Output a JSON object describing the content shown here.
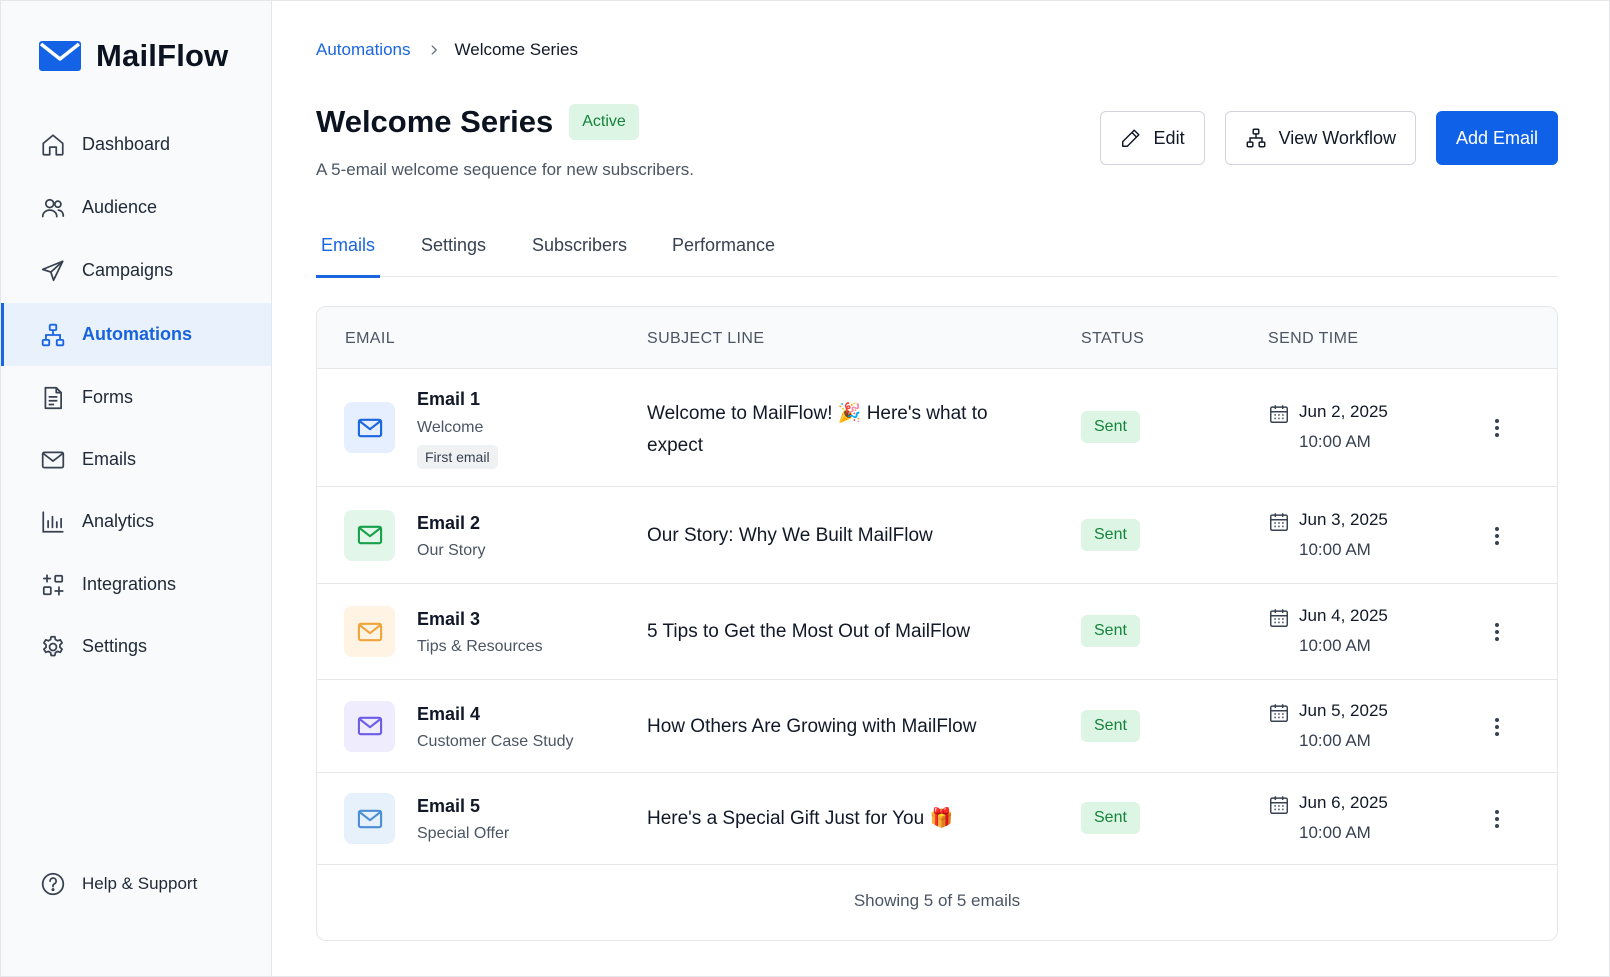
{
  "app": {
    "name": "MailFlow"
  },
  "colors": {
    "accent": "#1a66e0",
    "primary_button": "#0f62e8",
    "success_bg": "#dcf5e4",
    "success_text": "#16833b"
  },
  "sidebar": {
    "items": [
      {
        "label": "Dashboard",
        "icon": "home-icon",
        "active": false
      },
      {
        "label": "Audience",
        "icon": "users-icon",
        "active": false
      },
      {
        "label": "Campaigns",
        "icon": "send-icon",
        "active": false
      },
      {
        "label": "Automations",
        "icon": "workflow-icon",
        "active": true
      },
      {
        "label": "Forms",
        "icon": "form-icon",
        "active": false
      },
      {
        "label": "Emails",
        "icon": "mail-icon",
        "active": false
      },
      {
        "label": "Analytics",
        "icon": "bar-chart-icon",
        "active": false
      },
      {
        "label": "Integrations",
        "icon": "integrations-icon",
        "active": false
      },
      {
        "label": "Settings",
        "icon": "gear-icon",
        "active": false
      }
    ],
    "help_label": "Help & Support"
  },
  "breadcrumb": {
    "parent": "Automations",
    "current": "Welcome Series"
  },
  "header": {
    "title": "Welcome Series",
    "status": "Active",
    "description": "A 5-email welcome sequence for new subscribers.",
    "edit_label": "Edit",
    "view_workflow_label": "View Workflow",
    "add_email_label": "Add Email"
  },
  "tabs": [
    {
      "label": "Emails",
      "active": true
    },
    {
      "label": "Settings",
      "active": false
    },
    {
      "label": "Subscribers",
      "active": false
    },
    {
      "label": "Performance",
      "active": false
    }
  ],
  "table": {
    "columns": [
      "EMAIL",
      "SUBJECT LINE",
      "STATUS",
      "SEND TIME"
    ],
    "rows": [
      {
        "name": "Email 1",
        "type": "Welcome",
        "tag": "First email",
        "subject": "Welcome to MailFlow! 🎉 Here's what to expect",
        "status": "Sent",
        "date": "Jun 2, 2025",
        "time": "10:00 AM",
        "icon_color": "#1a66e0",
        "icon_bg": "#e6efff"
      },
      {
        "name": "Email 2",
        "type": "Our Story",
        "tag": "",
        "subject": "Our Story: Why We Built MailFlow",
        "status": "Sent",
        "date": "Jun 3, 2025",
        "time": "10:00 AM",
        "icon_color": "#18a04a",
        "icon_bg": "#e3f6ea"
      },
      {
        "name": "Email 3",
        "type": "Tips & Resources",
        "tag": "",
        "subject": "5 Tips to Get the Most Out of MailFlow",
        "status": "Sent",
        "date": "Jun 4, 2025",
        "time": "10:00 AM",
        "icon_color": "#f0a53a",
        "icon_bg": "#fff3e3"
      },
      {
        "name": "Email 4",
        "type": "Customer Case Study",
        "tag": "",
        "subject": "How Others Are Growing with MailFlow",
        "status": "Sent",
        "date": "Jun 5, 2025",
        "time": "10:00 AM",
        "icon_color": "#6c5ce7",
        "icon_bg": "#efedfd"
      },
      {
        "name": "Email 5",
        "type": "Special Offer",
        "tag": "",
        "subject": "Here's a Special Gift Just for You 🎁",
        "status": "Sent",
        "date": "Jun 6, 2025",
        "time": "10:00 AM",
        "icon_color": "#4a8fd6",
        "icon_bg": "#e7f1fb"
      }
    ],
    "footer": "Showing 5 of 5 emails"
  }
}
